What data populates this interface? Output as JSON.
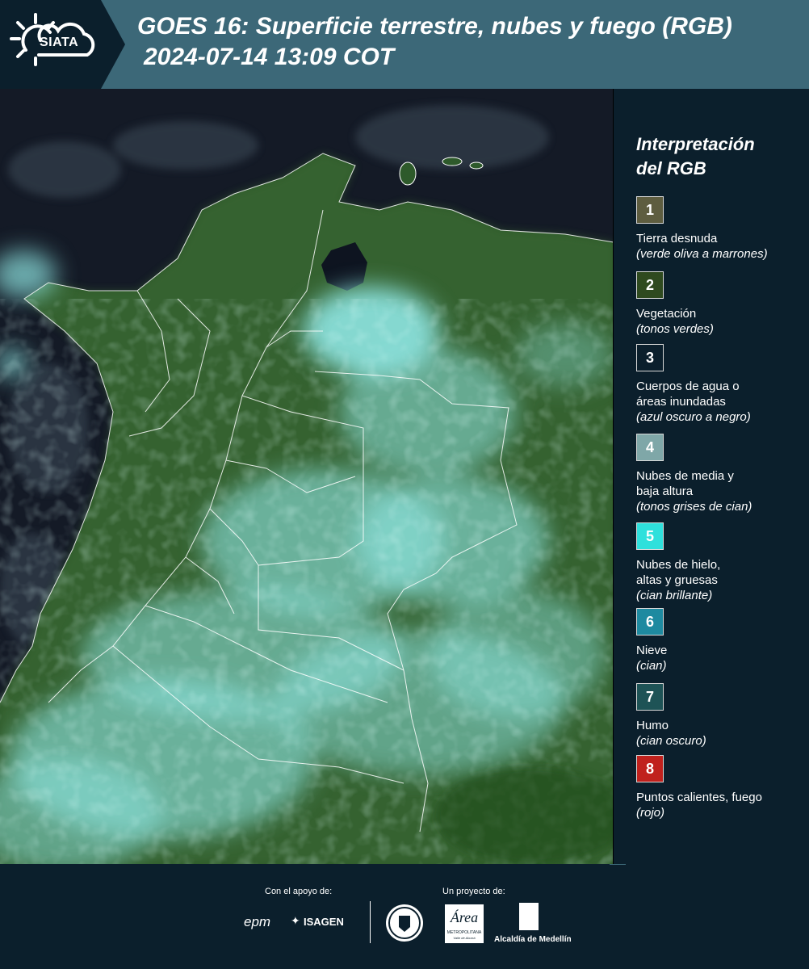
{
  "header": {
    "logo_text": "SIATA",
    "title": "GOES 16: Superficie terrestre, nubes y fuego (RGB)",
    "datetime": "2024-07-14 13:09 COT"
  },
  "legend": {
    "title_line1": "Interpretación",
    "title_line2": "del RGB",
    "items": [
      {
        "num": "1",
        "color": "#5e5d40",
        "label_lines": [
          "Tierra desnuda"
        ],
        "desc": "(verde oliva a marrones)"
      },
      {
        "num": "2",
        "color": "#2f4a1f",
        "label_lines": [
          "Vegetación"
        ],
        "desc": "(tonos verdes)"
      },
      {
        "num": "3",
        "color": "#0b1f2c",
        "label_lines": [
          "Cuerpos de agua o",
          "áreas inundadas"
        ],
        "desc": "(azul oscuro a negro)"
      },
      {
        "num": "4",
        "color": "#7fa7a8",
        "label_lines": [
          "Nubes de media y",
          "baja altura"
        ],
        "desc": "(tonos grises de cian)"
      },
      {
        "num": "5",
        "color": "#2fe0dc",
        "label_lines": [
          "Nubes de hielo,",
          "altas y gruesas"
        ],
        "desc": "(cian brillante)"
      },
      {
        "num": "6",
        "color": "#1e8aa0",
        "label_lines": [
          "Nieve"
        ],
        "desc": "(cian)"
      },
      {
        "num": "7",
        "color": "#1e5356",
        "label_lines": [
          "Humo"
        ],
        "desc": "(cian oscuro)"
      },
      {
        "num": "8",
        "color": "#c0211d",
        "label_lines": [
          "Puntos calientes, fuego"
        ],
        "desc": "(rojo)"
      }
    ]
  },
  "footer": {
    "support_label": "Con el apoyo de:",
    "project_label": "Un proyecto de:",
    "partner_epm": "epm",
    "partner_isagen": "ISAGEN",
    "partner_area": "Área",
    "partner_area_sub": "METROPOLITANA",
    "partner_area_sub2": "Valle de Aburrá",
    "partner_medellin": "Alcaldía de Medellín"
  }
}
